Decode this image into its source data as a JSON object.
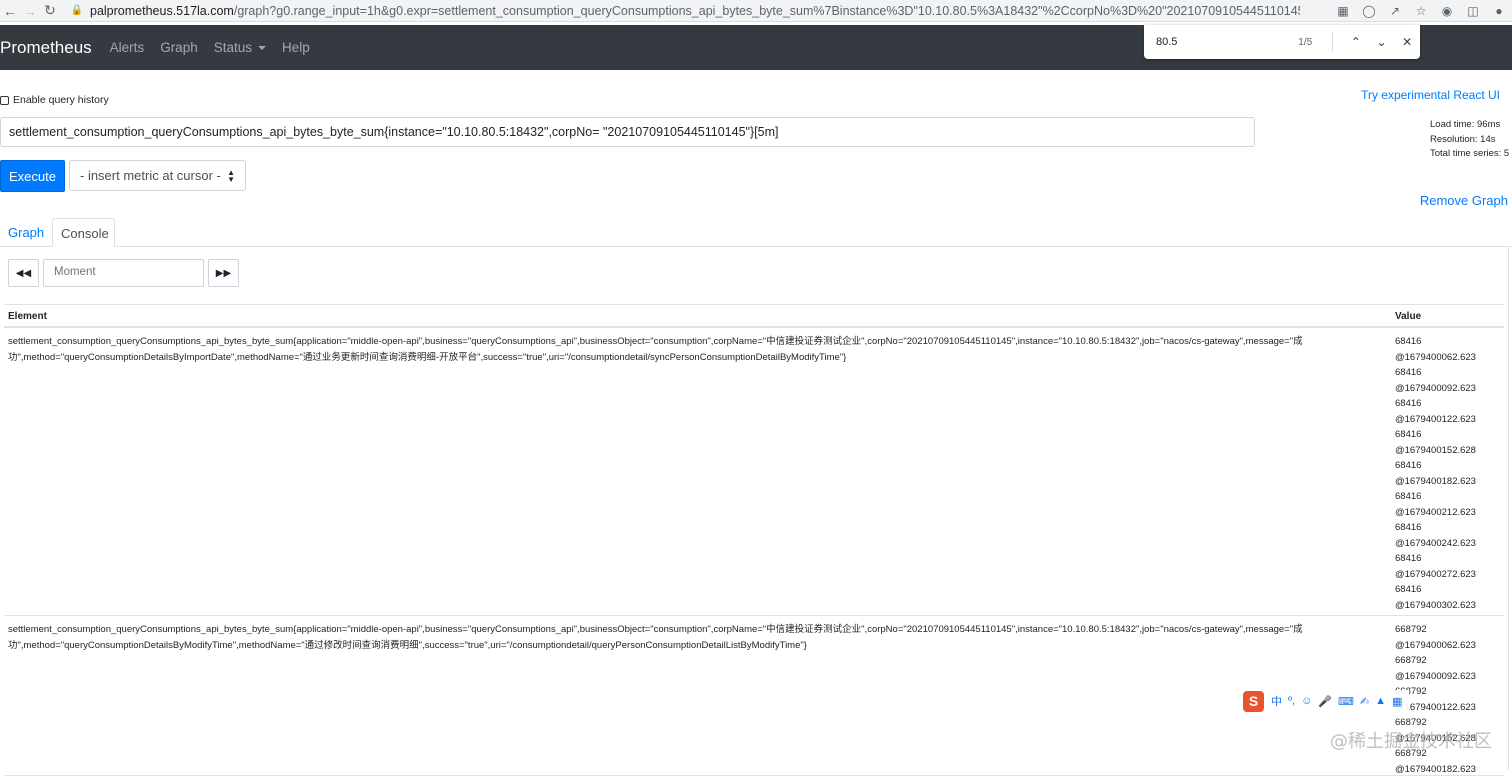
{
  "browser": {
    "url_host": "palprometheus.517la.com",
    "url_path": "/graph?g0.range_input=1h&g0.expr=settlement_consumption_queryConsumptions_api_bytes_byte_sum%7Binstance%3D\"10.10.80.5%3A18432\"%2CcorpNo%3D%20\"20210709105445110145\"%7D..."
  },
  "find": {
    "query": "80.5",
    "count": "1/5"
  },
  "navbar": {
    "brand": "Prometheus",
    "alerts": "Alerts",
    "graph": "Graph",
    "status": "Status",
    "help": "Help"
  },
  "query": {
    "enable_history": "Enable query history",
    "react_link": "Try experimental React UI",
    "expression": "settlement_consumption_queryConsumptions_api_bytes_byte_sum{instance=\"10.10.80.5:18432\",corpNo= \"20210709105445110145\"}[5m]",
    "load_time": "Load time: 96ms",
    "resolution": "Resolution: 14s",
    "total_series": "Total time series: 5",
    "execute": "Execute",
    "insert_metric": "- insert metric at cursor -",
    "remove_graph": "Remove Graph"
  },
  "tabs": {
    "graph": "Graph",
    "console": "Console"
  },
  "console": {
    "moment_placeholder": "Moment",
    "col_element": "Element",
    "col_value": "Value",
    "rows": [
      {
        "element": "settlement_consumption_queryConsumptions_api_bytes_byte_sum{application=\"middle-open-api\",business=\"queryConsumptions_api\",businessObject=\"consumption\",corpName=\"中信建投证券测试企业\",corpNo=\"20210709105445110145\",instance=\"10.10.80.5:18432\",job=\"nacos/cs-gateway\",message=\"成功\",method=\"queryConsumptionDetailsByImportDate\",methodName=\"通过业务更新时间查询消费明细-开放平台\",success=\"true\",uri=\"/consumptiondetail/syncPersonConsumptionDetailByModifyTime\"}",
        "values": [
          "68416",
          "@1679400062.623",
          "68416",
          "@1679400092.623",
          "68416",
          "@1679400122.623",
          "68416",
          "@1679400152.628",
          "68416",
          "@1679400182.623",
          "68416",
          "@1679400212.623",
          "68416",
          "@1679400242.623",
          "68416",
          "@1679400272.623",
          "68416",
          "@1679400302.623"
        ]
      },
      {
        "element": "settlement_consumption_queryConsumptions_api_bytes_byte_sum{application=\"middle-open-api\",business=\"queryConsumptions_api\",businessObject=\"consumption\",corpName=\"中信建投证券测试企业\",corpNo=\"20210709105445110145\",instance=\"10.10.80.5:18432\",job=\"nacos/cs-gateway\",message=\"成功\",method=\"queryConsumptionDetailsByModifyTime\",methodName=\"通过修改时间查询消费明细\",success=\"true\",uri=\"/consumptiondetail/queryPersonConsumptionDetailListByModifyTime\"}",
        "values": [
          "668792",
          "@1679400062.623",
          "668792",
          "@1679400092.623",
          "668792",
          "@1679400122.623",
          "668792",
          "@1679400152.628",
          "668792",
          "@1679400182.623"
        ]
      }
    ]
  },
  "overlay": {
    "ime_label": "中",
    "watermark": "@稀土掘金技术社区"
  }
}
